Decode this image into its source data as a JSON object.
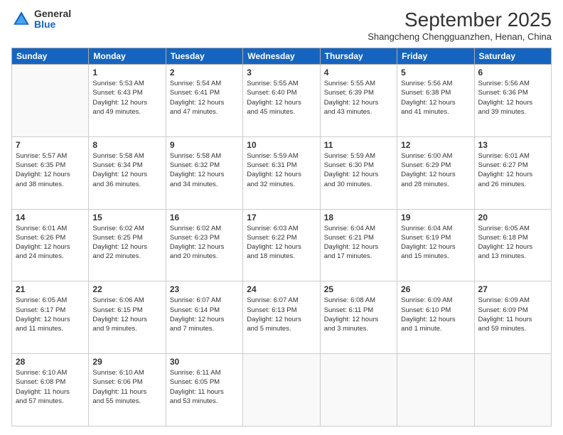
{
  "logo": {
    "general": "General",
    "blue": "Blue"
  },
  "header": {
    "title": "September 2025",
    "subtitle": "Shangcheng Chengguanzhen, Henan, China"
  },
  "weekdays": [
    "Sunday",
    "Monday",
    "Tuesday",
    "Wednesday",
    "Thursday",
    "Friday",
    "Saturday"
  ],
  "weeks": [
    [
      {
        "day": "",
        "info": ""
      },
      {
        "day": "1",
        "info": "Sunrise: 5:53 AM\nSunset: 6:43 PM\nDaylight: 12 hours\nand 49 minutes."
      },
      {
        "day": "2",
        "info": "Sunrise: 5:54 AM\nSunset: 6:41 PM\nDaylight: 12 hours\nand 47 minutes."
      },
      {
        "day": "3",
        "info": "Sunrise: 5:55 AM\nSunset: 6:40 PM\nDaylight: 12 hours\nand 45 minutes."
      },
      {
        "day": "4",
        "info": "Sunrise: 5:55 AM\nSunset: 6:39 PM\nDaylight: 12 hours\nand 43 minutes."
      },
      {
        "day": "5",
        "info": "Sunrise: 5:56 AM\nSunset: 6:38 PM\nDaylight: 12 hours\nand 41 minutes."
      },
      {
        "day": "6",
        "info": "Sunrise: 5:56 AM\nSunset: 6:36 PM\nDaylight: 12 hours\nand 39 minutes."
      }
    ],
    [
      {
        "day": "7",
        "info": "Sunrise: 5:57 AM\nSunset: 6:35 PM\nDaylight: 12 hours\nand 38 minutes."
      },
      {
        "day": "8",
        "info": "Sunrise: 5:58 AM\nSunset: 6:34 PM\nDaylight: 12 hours\nand 36 minutes."
      },
      {
        "day": "9",
        "info": "Sunrise: 5:58 AM\nSunset: 6:32 PM\nDaylight: 12 hours\nand 34 minutes."
      },
      {
        "day": "10",
        "info": "Sunrise: 5:59 AM\nSunset: 6:31 PM\nDaylight: 12 hours\nand 32 minutes."
      },
      {
        "day": "11",
        "info": "Sunrise: 5:59 AM\nSunset: 6:30 PM\nDaylight: 12 hours\nand 30 minutes."
      },
      {
        "day": "12",
        "info": "Sunrise: 6:00 AM\nSunset: 6:29 PM\nDaylight: 12 hours\nand 28 minutes."
      },
      {
        "day": "13",
        "info": "Sunrise: 6:01 AM\nSunset: 6:27 PM\nDaylight: 12 hours\nand 26 minutes."
      }
    ],
    [
      {
        "day": "14",
        "info": "Sunrise: 6:01 AM\nSunset: 6:26 PM\nDaylight: 12 hours\nand 24 minutes."
      },
      {
        "day": "15",
        "info": "Sunrise: 6:02 AM\nSunset: 6:25 PM\nDaylight: 12 hours\nand 22 minutes."
      },
      {
        "day": "16",
        "info": "Sunrise: 6:02 AM\nSunset: 6:23 PM\nDaylight: 12 hours\nand 20 minutes."
      },
      {
        "day": "17",
        "info": "Sunrise: 6:03 AM\nSunset: 6:22 PM\nDaylight: 12 hours\nand 18 minutes."
      },
      {
        "day": "18",
        "info": "Sunrise: 6:04 AM\nSunset: 6:21 PM\nDaylight: 12 hours\nand 17 minutes."
      },
      {
        "day": "19",
        "info": "Sunrise: 6:04 AM\nSunset: 6:19 PM\nDaylight: 12 hours\nand 15 minutes."
      },
      {
        "day": "20",
        "info": "Sunrise: 6:05 AM\nSunset: 6:18 PM\nDaylight: 12 hours\nand 13 minutes."
      }
    ],
    [
      {
        "day": "21",
        "info": "Sunrise: 6:05 AM\nSunset: 6:17 PM\nDaylight: 12 hours\nand 11 minutes."
      },
      {
        "day": "22",
        "info": "Sunrise: 6:06 AM\nSunset: 6:15 PM\nDaylight: 12 hours\nand 9 minutes."
      },
      {
        "day": "23",
        "info": "Sunrise: 6:07 AM\nSunset: 6:14 PM\nDaylight: 12 hours\nand 7 minutes."
      },
      {
        "day": "24",
        "info": "Sunrise: 6:07 AM\nSunset: 6:13 PM\nDaylight: 12 hours\nand 5 minutes."
      },
      {
        "day": "25",
        "info": "Sunrise: 6:08 AM\nSunset: 6:11 PM\nDaylight: 12 hours\nand 3 minutes."
      },
      {
        "day": "26",
        "info": "Sunrise: 6:09 AM\nSunset: 6:10 PM\nDaylight: 12 hours\nand 1 minute."
      },
      {
        "day": "27",
        "info": "Sunrise: 6:09 AM\nSunset: 6:09 PM\nDaylight: 11 hours\nand 59 minutes."
      }
    ],
    [
      {
        "day": "28",
        "info": "Sunrise: 6:10 AM\nSunset: 6:08 PM\nDaylight: 11 hours\nand 57 minutes."
      },
      {
        "day": "29",
        "info": "Sunrise: 6:10 AM\nSunset: 6:06 PM\nDaylight: 11 hours\nand 55 minutes."
      },
      {
        "day": "30",
        "info": "Sunrise: 6:11 AM\nSunset: 6:05 PM\nDaylight: 11 hours\nand 53 minutes."
      },
      {
        "day": "",
        "info": ""
      },
      {
        "day": "",
        "info": ""
      },
      {
        "day": "",
        "info": ""
      },
      {
        "day": "",
        "info": ""
      }
    ]
  ]
}
